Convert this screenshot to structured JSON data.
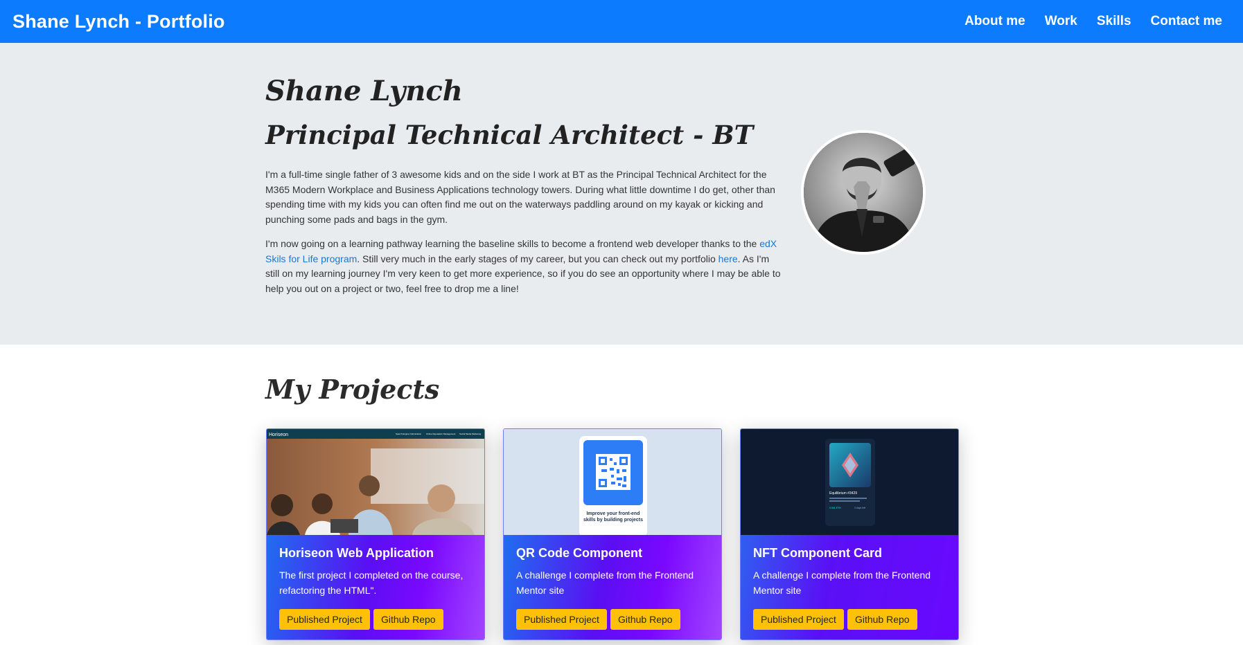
{
  "navbar": {
    "brand": "Shane Lynch - Portfolio",
    "links": [
      "About me",
      "Work",
      "Skills",
      "Contact me"
    ]
  },
  "hero": {
    "name": "Shane Lynch",
    "role": "Principal Technical Architect - BT",
    "paragraph1": "I'm a full-time single father of 3 awesome kids and on the side I work at BT as the Principal Technical Architect for the M365 Modern Workplace and Business Applications technology towers. During what little downtime I do get, other than spending time with my kids you can often find me out on the waterways paddling around on my kayak or kicking and punching some pads and bags in the gym.",
    "paragraph2_a": "I'm now going on a learning pathway learning the baseline skills to become a frontend web developer thanks to the ",
    "paragraph2_link1": "edX Skils for Life program",
    "paragraph2_b": ". Still very much in the early stages of my career, but you can check out my portfolio ",
    "paragraph2_link2": "here",
    "paragraph2_c": ". As I'm still on my learning journey I'm very keen to get more experience, so if you do see an opportunity where I may be able to help you out on a project or two, feel free to drop me a line!"
  },
  "projects": {
    "title": "My Projects",
    "cards": [
      {
        "title": "Horiseon Web Application",
        "text": "The first project I completed on the course, refactoring the HTML\".",
        "btn_published": "Published Project",
        "btn_repo": "Github Repo",
        "thumb_header": "Horiseon",
        "thumb_nav": [
          "Search Engine Optimization",
          "Online Reputation Management",
          "Social Media Marketing"
        ]
      },
      {
        "title": "QR Code Component",
        "text": "A challenge I complete from the Frontend Mentor site",
        "btn_published": "Published Project",
        "btn_repo": "Github Repo",
        "thumb_caption": "Improve your front-end skills by building projects"
      },
      {
        "title": "NFT Component Card",
        "text": "A challenge I complete from the Frontend Mentor site",
        "btn_published": "Published Project",
        "btn_repo": "Github Repo",
        "thumb_title": "Equilibrium #3429",
        "thumb_price": "0.041 ETH",
        "thumb_days": "3 days left"
      }
    ]
  },
  "colors": {
    "navbar": "#0d7bfd",
    "hero_bg": "#e9ecef",
    "button": "#ffc107",
    "link": "#1976d2"
  }
}
